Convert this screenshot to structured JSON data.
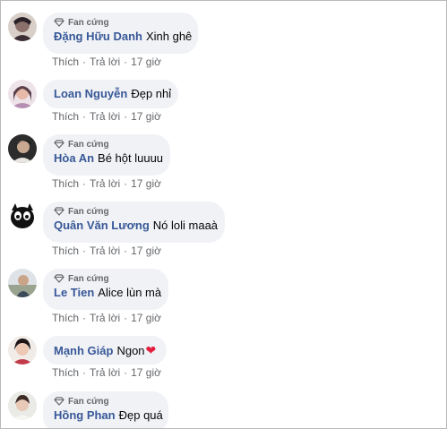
{
  "badge_label": "Fan cứng",
  "action_like": "Thích",
  "action_reply": "Trả lời",
  "separator": "·",
  "comments": [
    {
      "author": "Đặng Hữu Danh",
      "text": "Xinh ghê",
      "time": "17 giờ",
      "has_badge": true
    },
    {
      "author": "Loan Nguyễn",
      "text": "Đẹp nhỉ",
      "time": "17 giờ",
      "has_badge": false
    },
    {
      "author": "Hòa An",
      "text": "Bé hột luuuu",
      "time": "17 giờ",
      "has_badge": true
    },
    {
      "author": "Quân Văn Lương",
      "text": "Nó loli maaà",
      "time": "17 giờ",
      "has_badge": true
    },
    {
      "author": "Le Tien",
      "text": "Alice lùn mà",
      "time": "17 giờ",
      "has_badge": true
    },
    {
      "author": "Mạnh Giáp",
      "text": "Ngon",
      "emoji": "❤",
      "time": "17 giờ",
      "has_badge": false
    },
    {
      "author": "Hồng Phan",
      "text": "Đẹp quá",
      "time": "",
      "has_badge": true
    }
  ],
  "colors": {
    "bubble_bg": "#f0f2f5",
    "author": "#385898",
    "meta": "#65676b",
    "heart": "#e41e3f"
  }
}
